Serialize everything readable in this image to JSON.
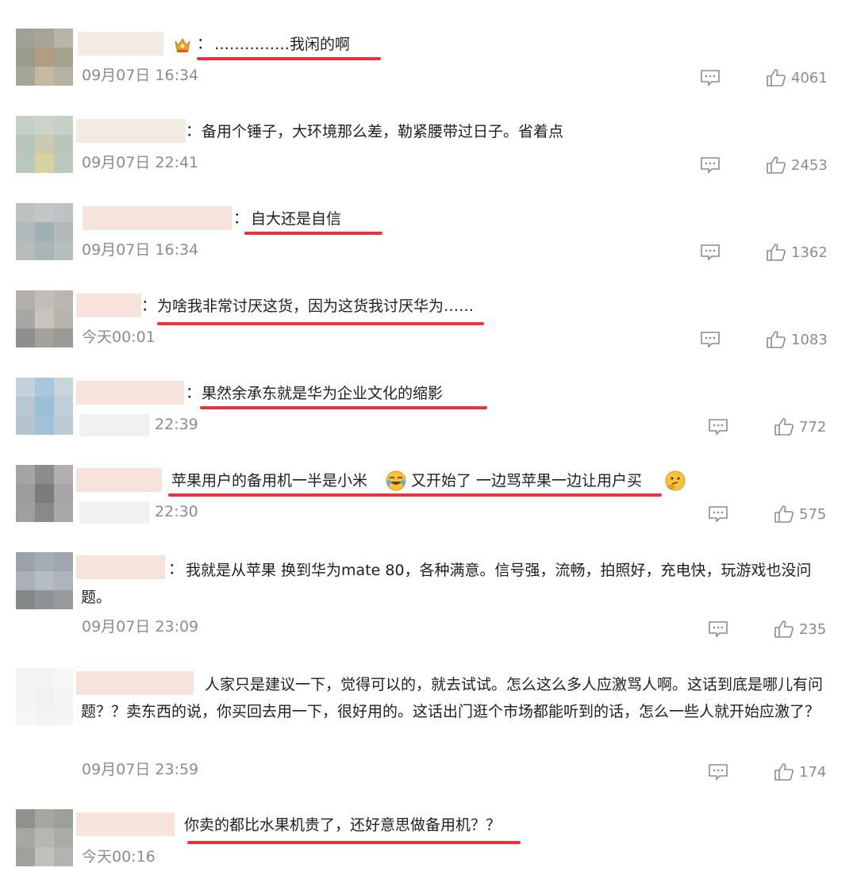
{
  "comments": [
    {
      "text": "……………我闲的啊",
      "time": "09月07日 16:34",
      "likes": "4061"
    },
    {
      "text": "备用个锤子，大环境那么差，勒紧腰带过日子。省着点",
      "time": "09月07日 22:41",
      "likes": "2453"
    },
    {
      "text": "自大还是自信",
      "time": "09月07日 16:34",
      "likes": "1362"
    },
    {
      "text": "为啥我非常讨厌这货，因为这货我讨厌华为……",
      "time": "今天00:01",
      "likes": "1083"
    },
    {
      "text": "果然余承东就是华为企业文化的缩影",
      "time": "22:39",
      "likes": "772"
    },
    {
      "text_a": "苹果用户的备用机一半是小米",
      "text_b": "又开始了 一边骂苹果一边让用户买",
      "time": "22:30",
      "likes": "575"
    },
    {
      "text": "我就是从苹果 换到华为mate 80，各种满意。信号强，流畅，拍照好，充电快，玩游戏也没问题。",
      "time": "09月07日 23:09",
      "likes": "235"
    },
    {
      "text": "人家只是建议一下，觉得可以的，就去试试。怎么这么多人应激骂人啊。这话到底是哪儿有问题？？卖东西的说，你买回去用一下，很好用的。这话出门逛个市场都能听到的话，怎么一些人就开始应激了？",
      "time": "09月07日 23:59",
      "likes": "174"
    },
    {
      "text": "你卖的都比水果机贵了，还好意思做备用机？？",
      "time": "今天00:16",
      "likes": ""
    }
  ],
  "separator": "：",
  "icons": {
    "reply": "comment-icon",
    "like": "thumbs-up-icon",
    "badge": "crown-badge-icon"
  },
  "colors": {
    "underline": "#e8343f",
    "meta": "#8c8c8c"
  }
}
